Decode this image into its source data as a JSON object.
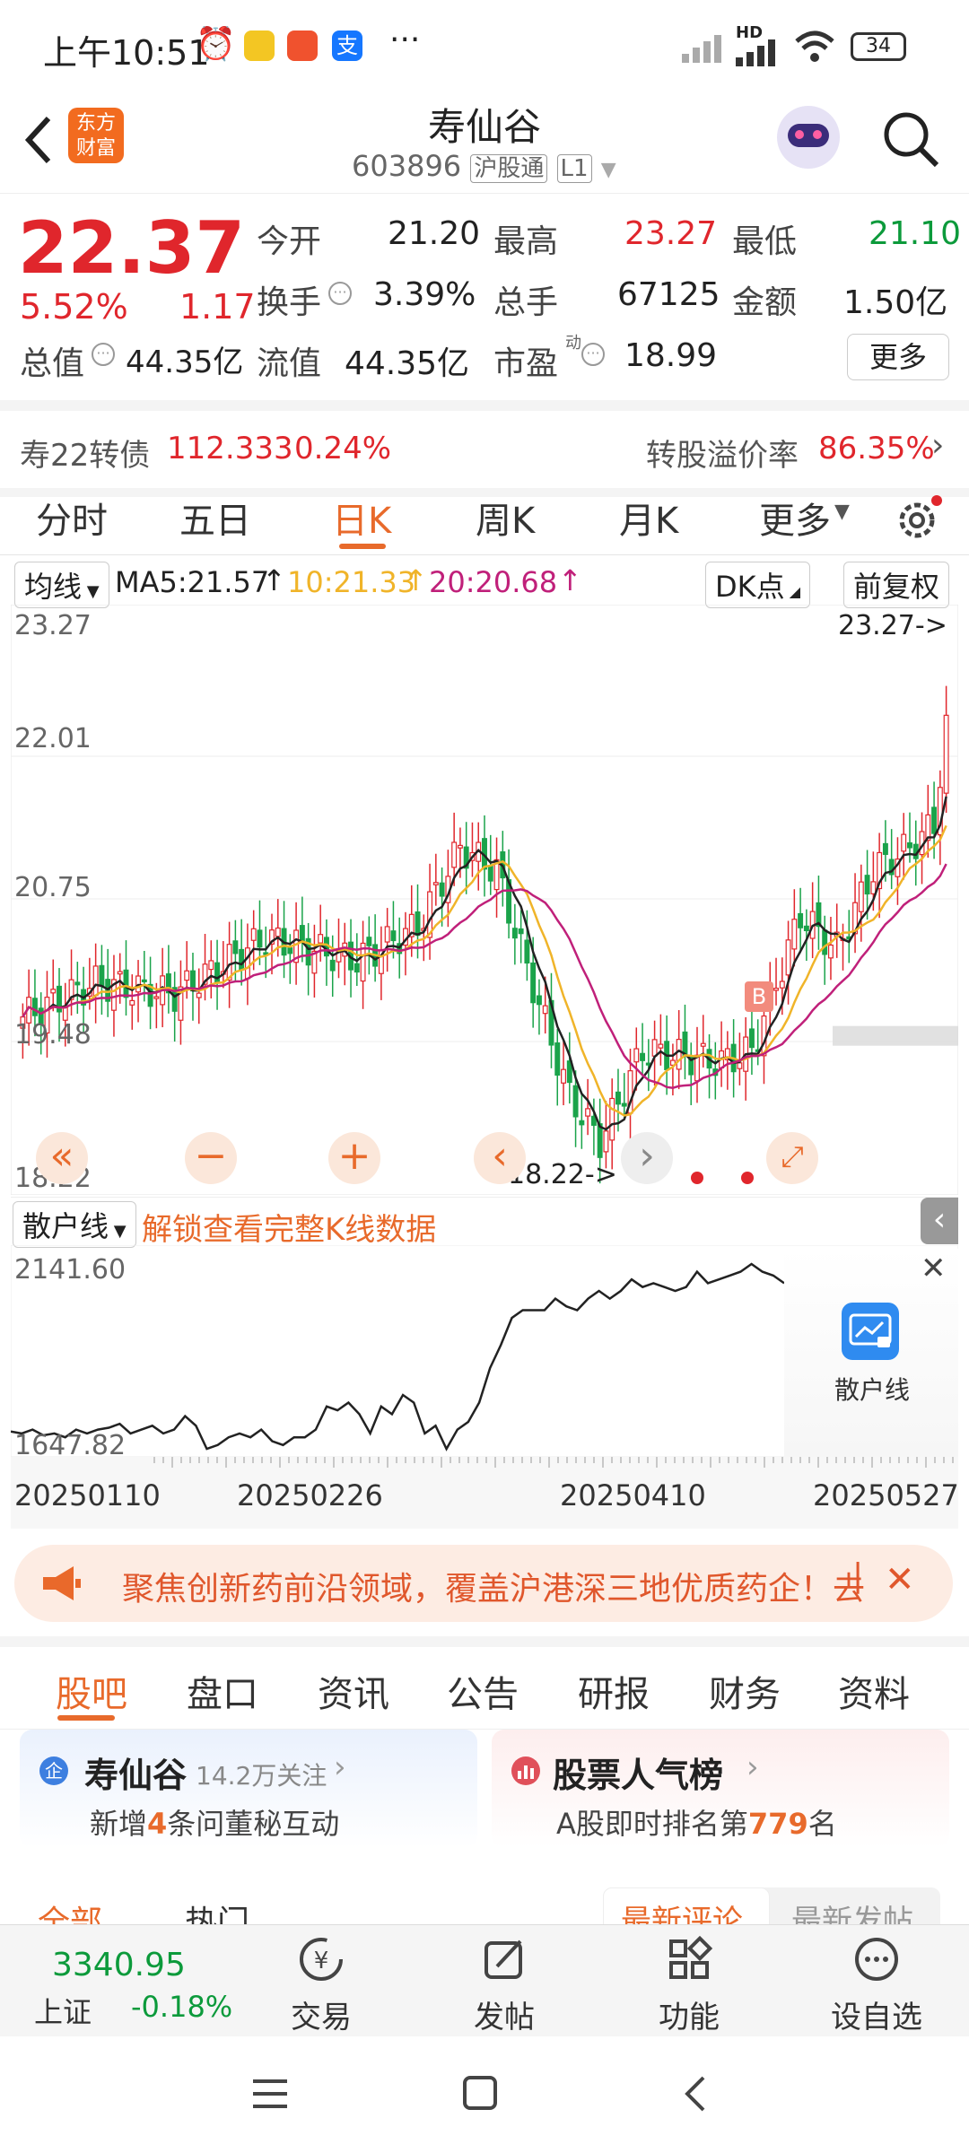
{
  "status": {
    "time": "上午10:51",
    "battery": "34",
    "net": "HD"
  },
  "header": {
    "title": "寿仙谷",
    "code": "603896",
    "tag1": "沪股通",
    "tag2": "L1",
    "logo_line1": "东方",
    "logo_line2": "财富"
  },
  "quote": {
    "price": "22.37",
    "pct": "5.52%",
    "chg": "1.17",
    "today_open_label": "今开",
    "today_open": "21.20",
    "high_label": "最高",
    "high": "23.27",
    "low_label": "最低",
    "low": "21.10",
    "turnover_label": "换手",
    "turnover": "3.39%",
    "volume_label": "总手",
    "volume": "67125",
    "amount_label": "金额",
    "amount": "1.50亿",
    "mktcap_label": "总值",
    "mktcap": "44.35亿",
    "float_label": "流值",
    "float": "44.35亿",
    "pe_label": "市盈",
    "pe_sup": "动",
    "pe": "18.99",
    "more": "更多"
  },
  "bond": {
    "name": "寿22转债",
    "price": "112.333",
    "pct": "0.24%",
    "premium_label": "转股溢价率",
    "premium": "86.35%"
  },
  "chart_tabs": [
    "分时",
    "五日",
    "日K",
    "周K",
    "月K",
    "更多"
  ],
  "chart_tabs_active": 2,
  "ma": {
    "selector": "均线",
    "ma5": "MA5:21.57",
    "ma10": "10:21.33",
    "ma20": "20:20.68",
    "dk": "DK点",
    "fq": "前复权"
  },
  "chart_data": [
    {
      "type": "candlestick",
      "yticks": [
        "23.27",
        "22.01",
        "20.75",
        "19.48",
        "18.22"
      ],
      "ylim": [
        18.22,
        23.27
      ],
      "annotations": [
        "23.27->",
        "18.22->",
        "B"
      ],
      "series": [
        {
          "name": "MA5",
          "color": "#222222"
        },
        {
          "name": "10",
          "color": "#f0b429"
        },
        {
          "name": "20",
          "color": "#c0207a"
        }
      ]
    },
    {
      "type": "line",
      "title": "散户线",
      "ylim": [
        1647.82,
        2141.6
      ],
      "yticks": [
        "2141.60",
        "1647.82"
      ],
      "xticks": [
        "20250110",
        "20250226",
        "20250410",
        "20250527"
      ],
      "values": [
        1695,
        1690,
        1700,
        1685,
        1690,
        1680,
        1700,
        1690,
        1700,
        1705,
        1715,
        1690,
        1700,
        1710,
        1690,
        1700,
        1735,
        1710,
        1650,
        1660,
        1680,
        1690,
        1680,
        1700,
        1670,
        1660,
        1680,
        1680,
        1700,
        1760,
        1750,
        1770,
        1740,
        1690,
        1760,
        1740,
        1790,
        1770,
        1690,
        1710,
        1650,
        1700,
        1720,
        1770,
        1860,
        1920,
        1990,
        2010,
        2010,
        2010,
        2040,
        2020,
        2010,
        2040,
        2060,
        2040,
        2060,
        2090,
        2070,
        2080,
        2070,
        2060,
        2070,
        2110,
        2080,
        2090,
        2100,
        2110,
        2130,
        2110,
        2100,
        2080
      ]
    }
  ],
  "indicator": {
    "selector": "散户线",
    "unlock": "解锁查看完整K线数据",
    "badge": "散户线"
  },
  "controls": {
    "low_label": "18.22->",
    "high_label": "23.27->"
  },
  "banner": {
    "text": "聚焦创新药前沿领域，覆盖沪港深三地优质药企！去"
  },
  "tabs2": [
    "股吧",
    "盘口",
    "资讯",
    "公告",
    "研报",
    "财务",
    "资料"
  ],
  "cards": {
    "left_title": "寿仙谷",
    "left_follow": "14.2万关注",
    "left_sub_pre": "新增",
    "left_sub_num": "4",
    "left_sub_post": "条问董秘互动",
    "right_title": "股票人气榜",
    "right_sub_pre": "A股即时排名第",
    "right_sub_num": "779",
    "right_sub_post": "名"
  },
  "subtabs": {
    "all": "全部",
    "hot": "热门",
    "latest_comment": "最新评论",
    "latest_post": "最新发帖"
  },
  "bottom": {
    "index_val": "3340.95",
    "index_name": "上证",
    "index_chg": "-0.18%",
    "trade": "交易",
    "post": "发帖",
    "func": "功能",
    "watch": "设自选"
  }
}
